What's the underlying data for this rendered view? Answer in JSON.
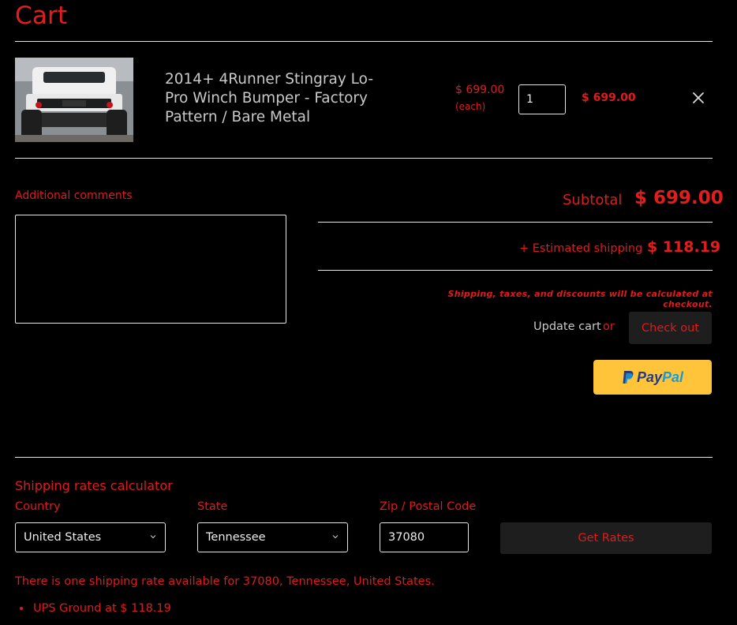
{
  "page": {
    "title": "Cart"
  },
  "cart_item": {
    "name": "2014+ 4Runner Stingray Lo-Pro Winch Bumper - Factory Pattern / Bare Metal",
    "unit_price": "$ 699.00",
    "unit_label": "(each)",
    "quantity": "1",
    "line_total": "$ 699.00",
    "image_alt": "Toyota 4Runner with Stingray winch bumper"
  },
  "comments": {
    "label": "Additional comments",
    "value": ""
  },
  "totals": {
    "subtotal_label": "Subtotal",
    "subtotal_value": "$ 699.00",
    "shipping_label": "+ Estimated shipping",
    "shipping_value": "$ 118.19",
    "note": "Shipping, taxes, and discounts will be calculated at checkout."
  },
  "actions": {
    "update_cart": "Update cart",
    "or": "or",
    "checkout": "Check out",
    "paypal_1": "Pay",
    "paypal_2": "Pal"
  },
  "shipping_calculator": {
    "title": "Shipping rates calculator",
    "country_label": "Country",
    "country_value": "United States",
    "state_label": "State",
    "state_value": "Tennessee",
    "zip_label": "Zip / Postal Code",
    "zip_value": "37080",
    "get_rates": "Get Rates",
    "result_message": "There is one shipping rate available for 37080, Tennessee, United States.",
    "rates": [
      "UPS Ground at $ 118.19"
    ]
  },
  "colors": {
    "accent": "#e01b1b",
    "background": "#000000",
    "button_bg": "#1e1e1e",
    "paypal_bg": "#ffc439"
  }
}
